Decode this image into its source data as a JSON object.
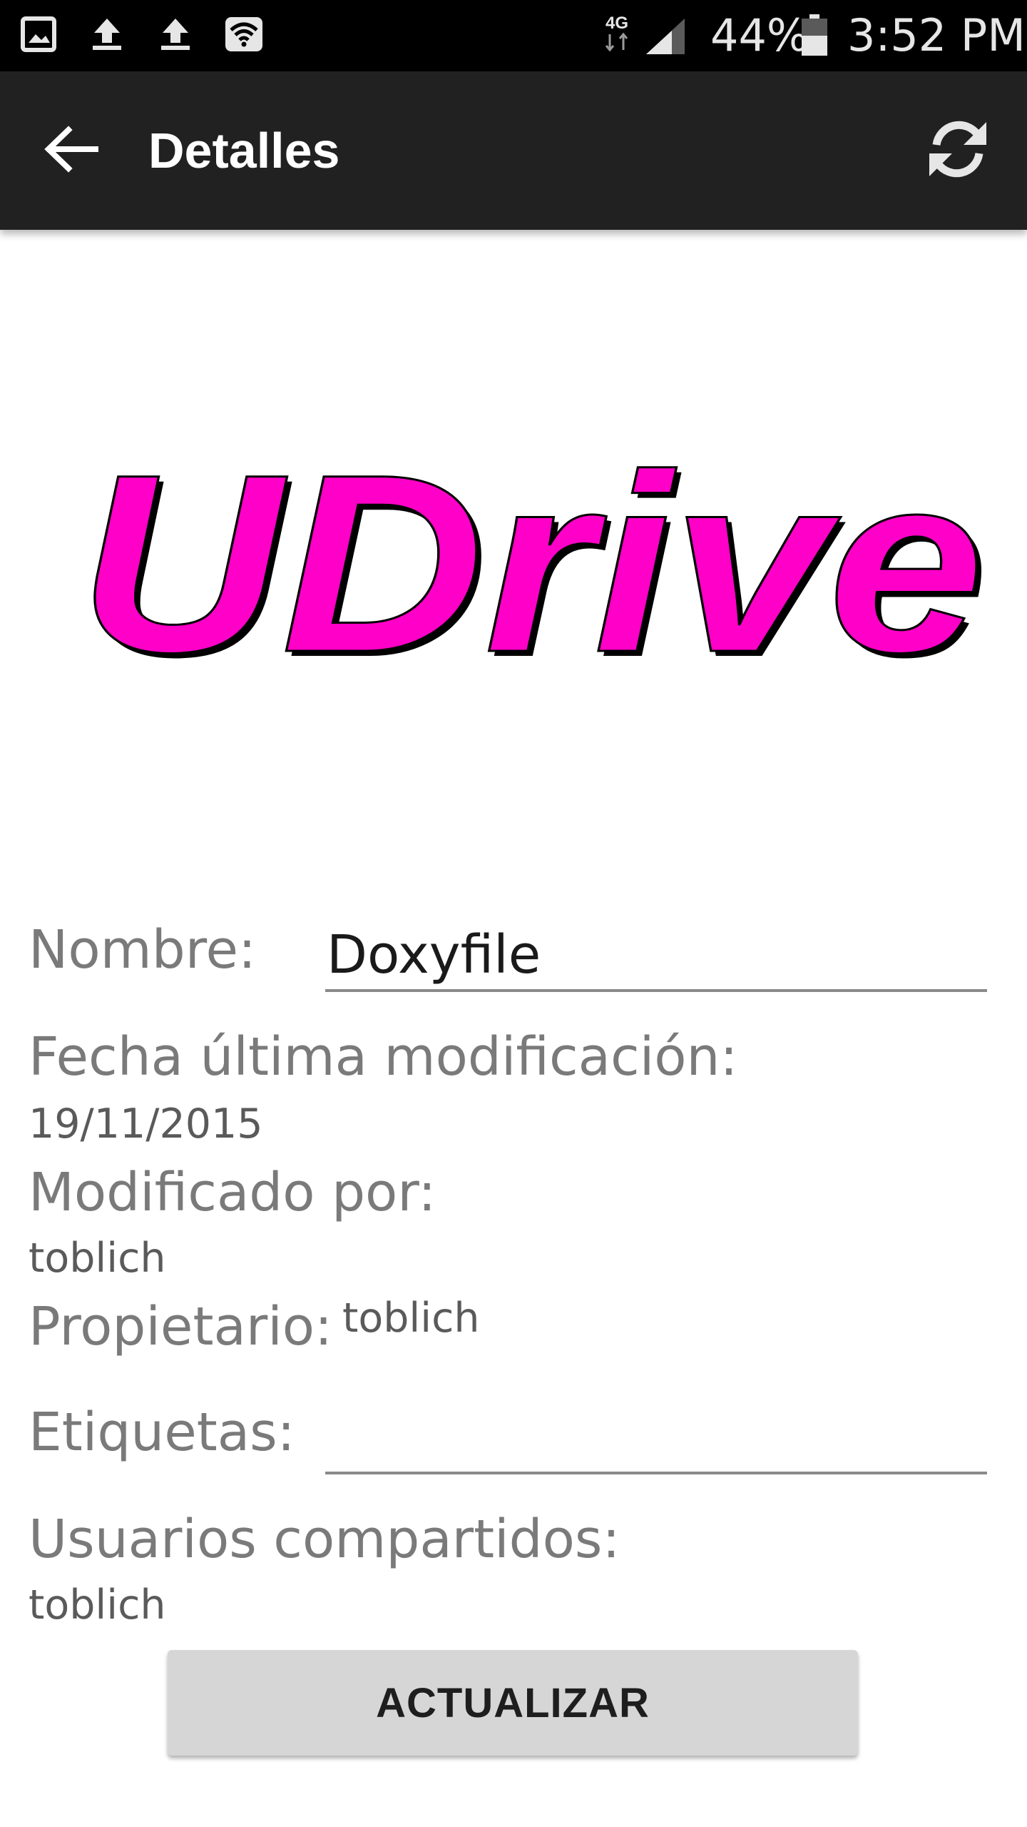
{
  "status_bar": {
    "network": "4G",
    "battery": "44%",
    "time": "3:52 PM",
    "icons": [
      "gallery-icon",
      "upload-icon",
      "upload-icon",
      "wifi-icon",
      "network-4g-icon",
      "signal-icon",
      "battery-icon"
    ]
  },
  "toolbar": {
    "title": "Detalles",
    "back_icon": "arrow-back-icon",
    "refresh_icon": "refresh-icon"
  },
  "logo": {
    "text": "UDrive",
    "color": "#ff00c8"
  },
  "form": {
    "name_label": "Nombre:",
    "name_value": "Doxyfile",
    "date_label": "Fecha última modificación:",
    "date_value": "19/11/2015",
    "modified_by_label": "Modificado por:",
    "modified_by_value": "toblich",
    "owner_label": "Propietario:",
    "owner_value": "toblich",
    "tags_label": "Etiquetas:",
    "tags_value": "",
    "shared_users_label": "Usuarios compartidos:",
    "shared_users_value": "toblich"
  },
  "actions": {
    "update_label": "ACTUALIZAR"
  }
}
